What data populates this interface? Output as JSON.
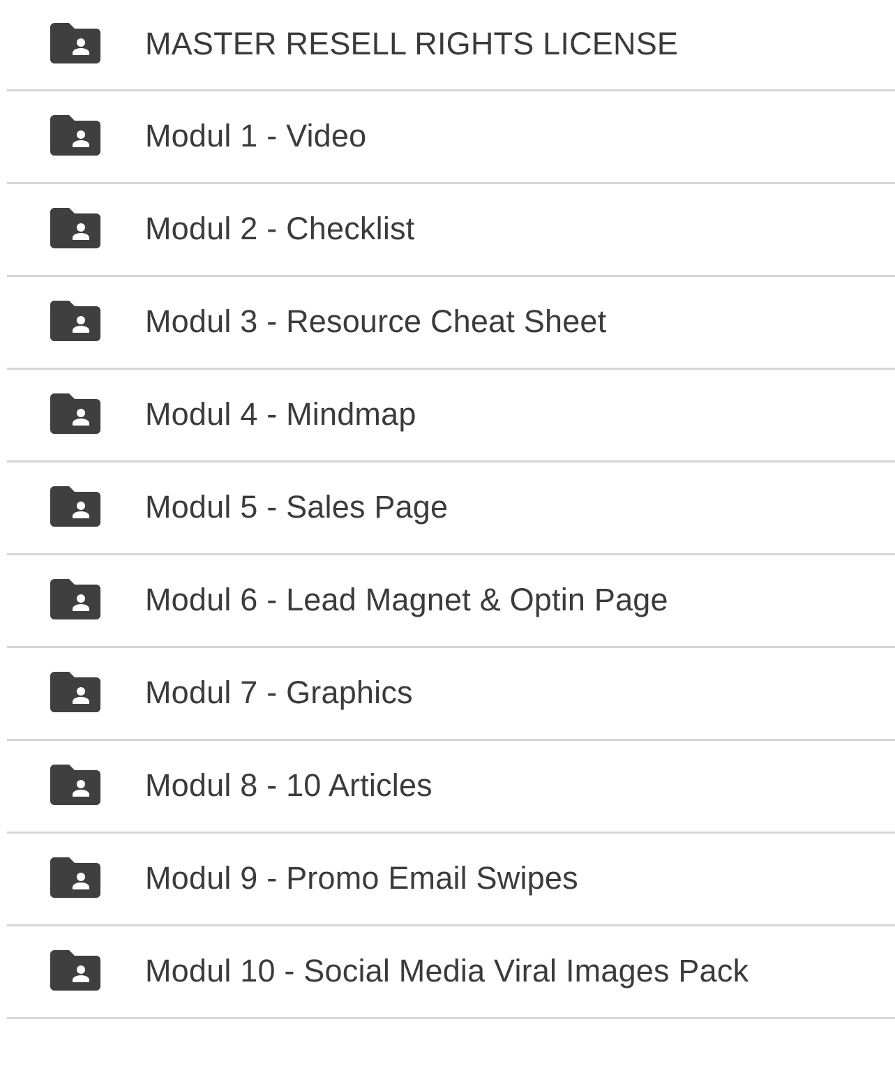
{
  "folders": [
    {
      "name": "MASTER RESELL RIGHTS LICENSE",
      "icon": "shared-folder-icon"
    },
    {
      "name": "Modul 1 - Video",
      "icon": "shared-folder-icon"
    },
    {
      "name": "Modul 2 - Checklist",
      "icon": "shared-folder-icon"
    },
    {
      "name": "Modul 3 - Resource Cheat Sheet",
      "icon": "shared-folder-icon"
    },
    {
      "name": "Modul 4 - Mindmap",
      "icon": "shared-folder-icon"
    },
    {
      "name": "Modul 5 - Sales Page",
      "icon": "shared-folder-icon"
    },
    {
      "name": "Modul 6 - Lead Magnet & Optin Page",
      "icon": "shared-folder-icon"
    },
    {
      "name": "Modul 7 - Graphics",
      "icon": "shared-folder-icon"
    },
    {
      "name": "Modul 8 - 10 Articles",
      "icon": "shared-folder-icon"
    },
    {
      "name": "Modul 9 - Promo Email Swipes",
      "icon": "shared-folder-icon"
    },
    {
      "name": "Modul 10 - Social Media Viral Images Pack",
      "icon": "shared-folder-icon"
    }
  ],
  "colors": {
    "icon": "#3f3f3f",
    "text": "#3b3b3b",
    "divider": "#d6d6d6",
    "background": "#ffffff"
  }
}
